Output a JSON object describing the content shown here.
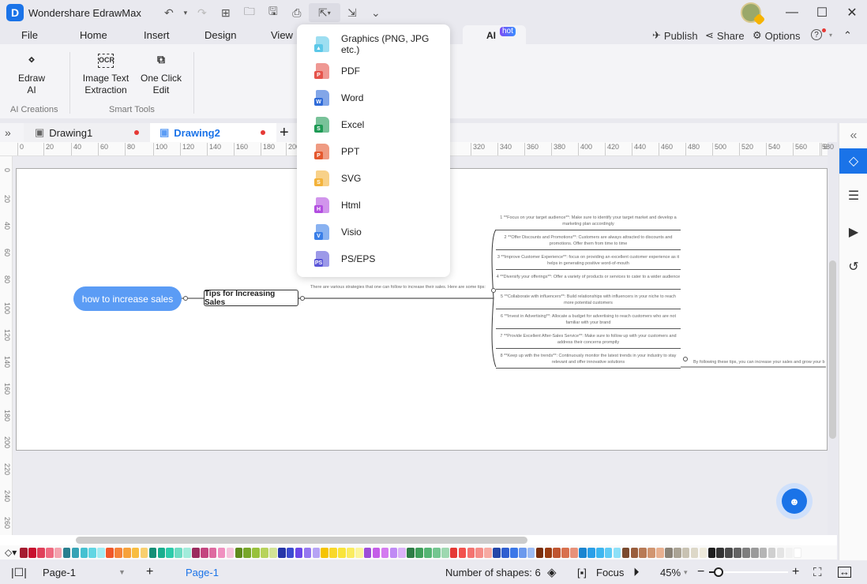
{
  "app": {
    "title": "Wondershare EdrawMax",
    "logo_letter": "D"
  },
  "quick_access": [
    {
      "name": "undo-icon",
      "glyph": "↶"
    },
    {
      "name": "dropdown-icon",
      "glyph": "▾"
    },
    {
      "name": "redo-icon",
      "glyph": "↷"
    },
    {
      "name": "new-icon",
      "glyph": "⊞"
    },
    {
      "name": "open-folder-icon",
      "glyph": "🗀"
    },
    {
      "name": "save-icon",
      "glyph": "🖫"
    },
    {
      "name": "print-icon",
      "glyph": "⎙"
    },
    {
      "name": "export-icon",
      "glyph": "⇱"
    },
    {
      "name": "import-icon",
      "glyph": "⇲"
    },
    {
      "name": "more-icon",
      "glyph": "⌄"
    }
  ],
  "window_controls": {
    "minimize": "—",
    "maximize": "☐",
    "close": "✕"
  },
  "menu": {
    "items": [
      "File",
      "Home",
      "Insert",
      "Design",
      "View"
    ],
    "ai_tab": "AI",
    "ai_badge": "hot"
  },
  "right_menu": {
    "publish": "Publish",
    "share": "Share",
    "options": "Options",
    "help": "?",
    "collapse": "⌃"
  },
  "ribbon": {
    "buttons": [
      {
        "label1": "Edraw",
        "label2": "AI",
        "icon": "edraw-ai-icon",
        "glyph": "⋄"
      },
      {
        "label1": "Image Text",
        "label2": "Extraction",
        "icon": "ocr-icon",
        "glyph": "OCR"
      },
      {
        "label1": "One Click",
        "label2": "Edit",
        "icon": "one-click-edit-icon",
        "glyph": "⧉"
      }
    ],
    "groups": [
      "AI Creations",
      "Smart Tools"
    ]
  },
  "tabs": {
    "expand": "»",
    "items": [
      {
        "label": "Drawing1",
        "active": false
      },
      {
        "label": "Drawing2",
        "active": true
      }
    ],
    "add": "+"
  },
  "ruler": {
    "h_ticks": [
      "0",
      "20",
      "40",
      "60",
      "80",
      "100",
      "120",
      "140",
      "160",
      "180",
      "200",
      "320",
      "340",
      "360",
      "380",
      "400",
      "420",
      "440",
      "460",
      "480",
      "500",
      "520",
      "540",
      "560",
      "580",
      "6"
    ],
    "v_ticks": [
      "0",
      "20",
      "40",
      "60",
      "80",
      "100",
      "120",
      "140",
      "160",
      "180",
      "200",
      "220",
      "240",
      "260"
    ]
  },
  "mindmap": {
    "root": "how to increase sales",
    "sub": "Tips for Increasing Sales",
    "intro": "There are various strategies that one can follow to increase their sales. Here are some tips:",
    "tips": [
      "1 **Focus on your target audience**: Make sure to identify your target market and develop a marketing plan accordingly",
      "2 **Offer Discounts and Promotions**: Customers are always attracted to discounts and promotions. Offer them from time to time",
      "3 **Improve Customer Experience**: focus on providing an excellent customer experience as it helps in generating positive word-of-mouth",
      "4 **Diversify your offerings**: Offer a variety of products or services to cater to a wider audience",
      "5 **Collaborate with influencers**: Build relationships with influencers in your niche to reach more potential customers",
      "6 **Invest in Advertising**: Allocate a budget for advertising to reach customers who are not familiar with your brand",
      "7 **Provide Excellent After-Sales Service**: Make sure to follow up with your customers and address their concerns promptly",
      "8 **Keep up with the trends**: Continuously monitor the latest trends in your industry to stay relevant and offer innovative solutions"
    ],
    "conclusion": "By following these tips, you can increase your sales and grow your b"
  },
  "export_menu": [
    {
      "label": "Graphics (PNG, JPG etc.)",
      "icon": "graphics-file-icon",
      "color": "#5cc8e8",
      "letter": "▲"
    },
    {
      "label": "PDF",
      "icon": "pdf-file-icon",
      "color": "#e5534b",
      "letter": "P"
    },
    {
      "label": "Word",
      "icon": "word-file-icon",
      "color": "#2f6bd8",
      "letter": "W"
    },
    {
      "label": "Excel",
      "icon": "excel-file-icon",
      "color": "#1e9a55",
      "letter": "S"
    },
    {
      "label": "PPT",
      "icon": "ppt-file-icon",
      "color": "#e4582e",
      "letter": "P"
    },
    {
      "label": "SVG",
      "icon": "svg-file-icon",
      "color": "#f3b23a",
      "letter": "S"
    },
    {
      "label": "Html",
      "icon": "html-file-icon",
      "color": "#b24ee0",
      "letter": "H"
    },
    {
      "label": "Visio",
      "icon": "visio-file-icon",
      "color": "#3a7fe8",
      "letter": "V"
    },
    {
      "label": "PS/EPS",
      "icon": "ps-eps-file-icon",
      "color": "#5a55d8",
      "letter": "PS"
    }
  ],
  "right_panel": [
    {
      "name": "collapse-panel-icon",
      "glyph": "«"
    },
    {
      "name": "fill-style-icon",
      "glyph": "◇"
    },
    {
      "name": "page-properties-icon",
      "glyph": "☰"
    },
    {
      "name": "presentation-icon",
      "glyph": "▶"
    },
    {
      "name": "history-icon",
      "glyph": "↺"
    }
  ],
  "palette": [
    "#a51c30",
    "#c8102e",
    "#e0405a",
    "#ef6b81",
    "#f4a3ae",
    "#2a7f8f",
    "#36a3b5",
    "#45c1d1",
    "#62d6e3",
    "#a3ecf2",
    "#f0582a",
    "#f5823a",
    "#f7a13a",
    "#f8bd41",
    "#f9cf6e",
    "#148f76",
    "#18ae8e",
    "#2ccbaa",
    "#6ddcc3",
    "#a2ecdb",
    "#9b2c5e",
    "#c4457f",
    "#de6aa0",
    "#f090c0",
    "#f5c3dc",
    "#5e8a1c",
    "#78a72a",
    "#98c13c",
    "#b7d35b",
    "#d2e396",
    "#2535a8",
    "#3b4bd0",
    "#6a47e8",
    "#9577f0",
    "#b6a3f5",
    "#f5c400",
    "#f9d82a",
    "#f9e43a",
    "#faec60",
    "#fbf59a",
    "#9d4ed8",
    "#c45ee8",
    "#d47af0",
    "#c08bf5",
    "#dbb3f8",
    "#2e7d46",
    "#3f9f5a",
    "#55b574",
    "#74c690",
    "#9ed8b0",
    "#e53935",
    "#f2514d",
    "#f47370",
    "#f58d88",
    "#f7aaa2",
    "#2447a8",
    "#2f5fd0",
    "#3b78e8",
    "#6b99ed",
    "#9cbbf3",
    "#7a2e0a",
    "#9a3c10",
    "#bf5530",
    "#d8704d",
    "#e8927a",
    "#1a85d0",
    "#2a9fe8",
    "#3db6f0",
    "#5fcbf5",
    "#8de0f8",
    "#7a4a2e",
    "#9a5e3c",
    "#b87a55",
    "#d19570",
    "#e8b090",
    "#8a8276",
    "#aaa394",
    "#c8c2b2",
    "#ddd8c8",
    "#eeeadb",
    "#1e1e1e",
    "#333333",
    "#4a4a4a",
    "#636363",
    "#7e7e7e",
    "#9a9a9a",
    "#b5b5b5",
    "#cfcfcf",
    "#e4e4e4",
    "#f2f2f2",
    "#ffffff"
  ],
  "status": {
    "page_select": "Page-1",
    "add_page": "+",
    "active_page": "Page-1",
    "shapes": "Number of shapes: 6",
    "focus": "Focus",
    "zoom": "45%",
    "zoom_minus": "−",
    "zoom_plus": "+",
    "zoom_level": 0.12
  }
}
